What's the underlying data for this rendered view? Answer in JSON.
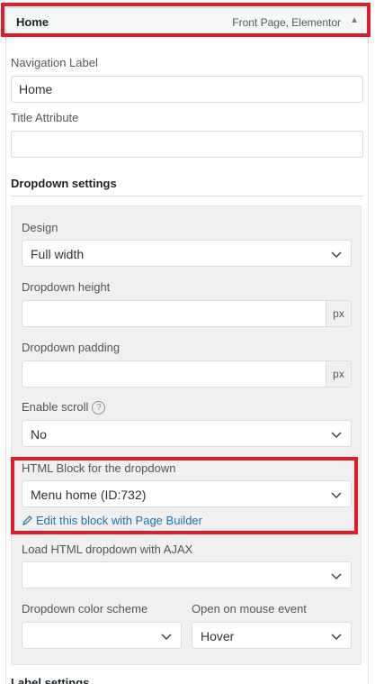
{
  "menu_item": {
    "title": "Home",
    "meta": "Front Page, Elementor"
  },
  "fields": {
    "nav_label": {
      "label": "Navigation Label",
      "value": "Home"
    },
    "title_attr": {
      "label": "Title Attribute",
      "value": ""
    }
  },
  "dropdown_settings": {
    "title": "Dropdown settings",
    "design": {
      "label": "Design",
      "value": "Full width"
    },
    "height": {
      "label": "Dropdown height",
      "unit": "px",
      "value": ""
    },
    "padding": {
      "label": "Dropdown padding",
      "unit": "px",
      "value": ""
    },
    "scroll": {
      "label": "Enable scroll",
      "help": "?",
      "value": "No"
    },
    "html_block": {
      "label": "HTML Block for the dropdown",
      "value": "Menu home (ID:732)",
      "edit_link": "Edit this block with Page Builder"
    },
    "ajax": {
      "label": "Load HTML dropdown with AJAX",
      "value": ""
    },
    "color_scheme": {
      "label": "Dropdown color scheme",
      "value": ""
    },
    "mouse_event": {
      "label": "Open on mouse event",
      "value": "Hover"
    }
  },
  "label_settings": {
    "title": "Label settings"
  },
  "colors": {
    "highlight": "#e01b2a",
    "link": "#2271b1",
    "panel": "#f0f0f1"
  }
}
